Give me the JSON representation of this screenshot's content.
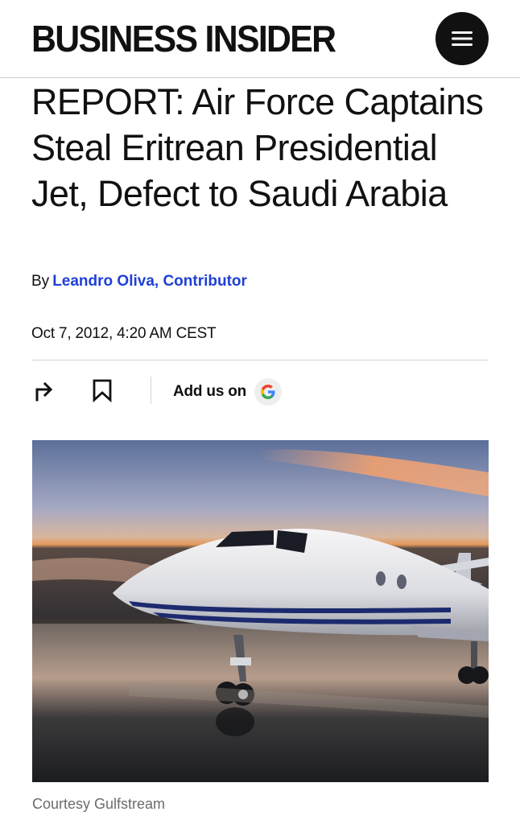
{
  "header": {
    "logo_text": "BUSINESS INSIDER",
    "menu_icon": "hamburger-menu-icon"
  },
  "article": {
    "headline": "REPORT: Air Force Captains Steal Eritrean Presidential Jet, Defect to Saudi Arabia",
    "byline_prefix": "By",
    "author": "Leandro Oliva, Contributor",
    "date": "Oct 7, 2012, 4:20 AM CEST",
    "actions": {
      "share_icon": "share-arrow-icon",
      "bookmark_icon": "bookmark-icon",
      "add_us_label": "Add us on",
      "google_icon": "google-g-icon"
    },
    "image": {
      "subject": "business jet on wet tarmac at sunset",
      "caption": "Courtesy Gulfstream"
    }
  },
  "colors": {
    "link": "#1f3fd6",
    "text": "#111111",
    "caption": "#6b6b6b",
    "divider": "#d4d4d4"
  }
}
